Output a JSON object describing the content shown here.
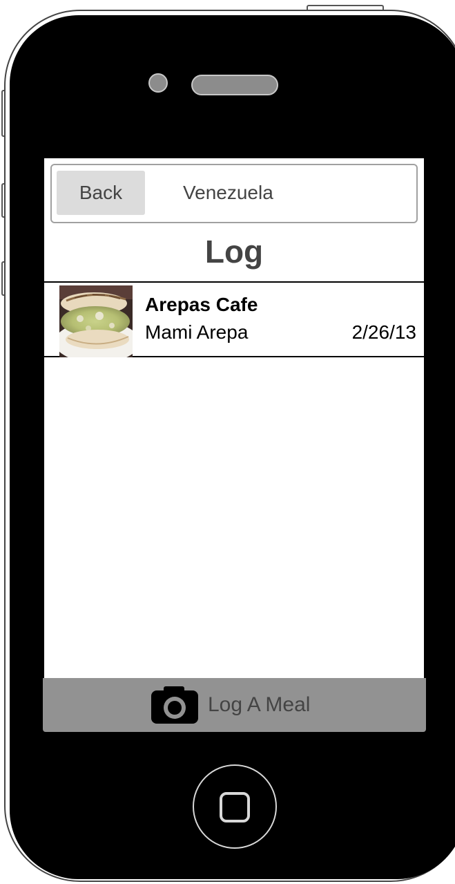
{
  "navbar": {
    "back_label": "Back",
    "title": "Venezuela"
  },
  "page": {
    "title": "Log"
  },
  "log_entries": [
    {
      "restaurant": "Arepas Cafe",
      "dish": "Mami Arepa",
      "date": "2/26/13",
      "photo_icon": "arepa-photo"
    }
  ],
  "bottom_bar": {
    "label": "Log A Meal",
    "icon": "camera-icon"
  },
  "colors": {
    "bottom_bar": "#929292",
    "back_button": "#dcdcdc",
    "text_muted": "#444444"
  }
}
